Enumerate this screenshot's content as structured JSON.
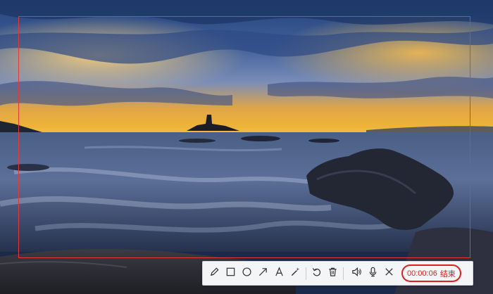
{
  "recording": {
    "elapsed": "00:00:06",
    "end_label": "结束"
  },
  "toolbar": {
    "tools": [
      {
        "icon": "pencil-icon"
      },
      {
        "icon": "rectangle-icon"
      },
      {
        "icon": "circle-icon"
      },
      {
        "icon": "arrow-icon"
      },
      {
        "icon": "text-icon"
      },
      {
        "icon": "magic-wand-icon"
      },
      {
        "icon": "undo-icon"
      },
      {
        "icon": "trash-icon"
      },
      {
        "icon": "speaker-icon"
      },
      {
        "icon": "microphone-icon"
      },
      {
        "icon": "close-icon"
      }
    ]
  },
  "colors": {
    "frame": "#e23a3a",
    "timer": "#d41f1f",
    "toolbar_bg": "#f4f5f7"
  }
}
